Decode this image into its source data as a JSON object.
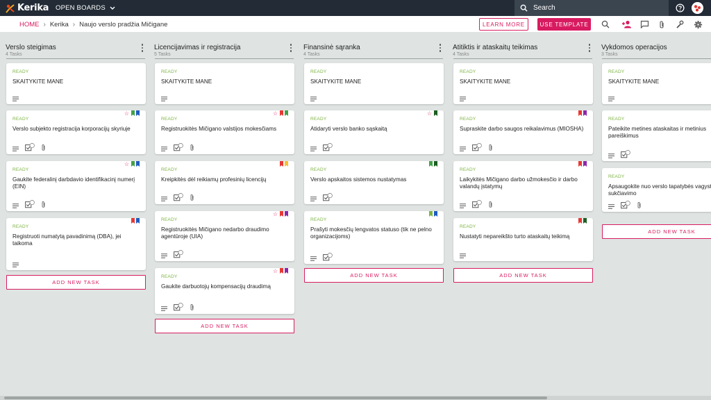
{
  "app": {
    "logo_text": "Kerika",
    "open_boards_label": "OPEN BOARDS",
    "search_placeholder": "Search"
  },
  "breadcrumb": {
    "home": "HOME",
    "account": "Kerika",
    "board": "Naujo verslo pradžia Mičigane"
  },
  "actions": {
    "learn_more": "LEARN MORE",
    "use_template": "USE TEMPLATE"
  },
  "icons": {
    "search": "search-icon",
    "help": "help-icon",
    "team": "add-person-icon",
    "chat": "chat-icon",
    "attach": "paperclip-icon",
    "tools": "wrench-icon",
    "settings": "gear-icon"
  },
  "colors": {
    "accent": "#d81b60",
    "ready": "#7cb342",
    "topbar": "#222b36",
    "board_bg": "#dfe4e2"
  },
  "add_task_label": "ADD NEW TASK",
  "columns": [
    {
      "title": "Verslo steigimas",
      "count": "4 Tasks",
      "cards": [
        {
          "status": "READY",
          "title": "SKAITYKITE MANE",
          "star": false,
          "flags": [],
          "checklist_count": null,
          "attachment": false
        },
        {
          "status": "READY",
          "title": "Verslo subjekto registracija korporacijų skyriuje",
          "star": true,
          "flags": [
            "#43a047",
            "#1e5bbf"
          ],
          "checklist_count": "7",
          "attachment": true
        },
        {
          "status": "READY",
          "title": "Gaukite federalinį darbdavio identifikacinį numerį (EIN)",
          "star": true,
          "flags": [
            "#43a047",
            "#1e5bbf"
          ],
          "checklist_count": "6",
          "attachment": true
        },
        {
          "status": "READY",
          "title": "Registruoti numatytą pavadinimą (DBA), jei taikoma",
          "star": false,
          "flags": [
            "#e53935",
            "#1e5bbf"
          ],
          "checklist_count": null,
          "attachment": false
        }
      ]
    },
    {
      "title": "Licencijavimas ir registracija",
      "count": "5 Tasks",
      "cards": [
        {
          "status": "READY",
          "title": "SKAITYKITE MANE",
          "star": false,
          "flags": [],
          "checklist_count": null,
          "attachment": false
        },
        {
          "status": "READY",
          "title": "Registruokitės Mičigano valstijos mokesčiams",
          "star": true,
          "flags": [
            "#e53935",
            "#43a047"
          ],
          "checklist_count": "5",
          "attachment": true
        },
        {
          "status": "READY",
          "title": "Kreipkitės dėl reikiamų profesinių licencijų",
          "star": false,
          "flags": [
            "#e53935",
            "#fbc02d"
          ],
          "checklist_count": "6",
          "attachment": true
        },
        {
          "status": "READY",
          "title": "Registruokitės Mičigano nedarbo draudimo agentūroje (UIA)",
          "star": true,
          "flags": [
            "#e53935",
            "#8e24aa"
          ],
          "checklist_count": "6",
          "attachment": false
        },
        {
          "status": "READY",
          "title": "Gaukite darbuotojų kompensacijų draudimą",
          "star": true,
          "flags": [
            "#e53935",
            "#8e24aa"
          ],
          "checklist_count": "6",
          "attachment": true
        }
      ]
    },
    {
      "title": "Finansinė sąranka",
      "count": "4 Tasks",
      "cards": [
        {
          "status": "READY",
          "title": "SKAITYKITE MANE",
          "star": false,
          "flags": [],
          "checklist_count": null,
          "attachment": false
        },
        {
          "status": "READY",
          "title": "Atidaryti verslo banko sąskaitą",
          "star": true,
          "flags": [
            "#1b5e20"
          ],
          "checklist_count": "6",
          "attachment": false
        },
        {
          "status": "READY",
          "title": "Verslo apskaitos sistemos nustatymas",
          "star": false,
          "flags": [
            "#43a047",
            "#1b5e20"
          ],
          "checklist_count": "6",
          "attachment": false
        },
        {
          "status": "READY",
          "title": "Prašyti mokesčių lengvatos statuso (tik ne pelno organizacijoms)",
          "star": false,
          "flags": [
            "#7cb342",
            "#1e5bbf"
          ],
          "checklist_count": "6",
          "attachment": false
        }
      ]
    },
    {
      "title": "Atitiktis ir ataskaitų teikimas",
      "count": "4 Tasks",
      "cards": [
        {
          "status": "READY",
          "title": "SKAITYKITE MANE",
          "star": false,
          "flags": [],
          "checklist_count": null,
          "attachment": false
        },
        {
          "status": "READY",
          "title": "Supraskite darbo saugos reikalavimus (MIOSHA)",
          "star": false,
          "flags": [
            "#e53935",
            "#8e24aa"
          ],
          "checklist_count": "6",
          "attachment": true
        },
        {
          "status": "READY",
          "title": "Laikykitės Mičigano darbo užmokesčio ir darbo valandų įstatymų",
          "star": false,
          "flags": [
            "#e53935",
            "#8e24aa"
          ],
          "checklist_count": "6",
          "attachment": true
        },
        {
          "status": "READY",
          "title": "Nustatyti nepareikšto turto ataskaitų teikimą",
          "star": false,
          "flags": [
            "#e53935",
            "#1b5e20"
          ],
          "checklist_count": null,
          "attachment": false
        }
      ]
    },
    {
      "title": "Vykdomos operacijos",
      "count": "3 Tasks",
      "cards": [
        {
          "status": "READY",
          "title": "SKAITYKITE MANE",
          "star": false,
          "flags": [],
          "checklist_count": null,
          "attachment": false
        },
        {
          "status": "READY",
          "title": "Pateikite metines ataskaitas ir metinius pareiškimus",
          "star": false,
          "flags": [],
          "checklist_count": "6",
          "attachment": false
        },
        {
          "status": "READY",
          "title": "Apsaugokite nuo verslo tapatybės vagystės ir sukčiavimo",
          "star": false,
          "flags": [],
          "checklist_count": "6",
          "attachment": true
        }
      ]
    }
  ]
}
